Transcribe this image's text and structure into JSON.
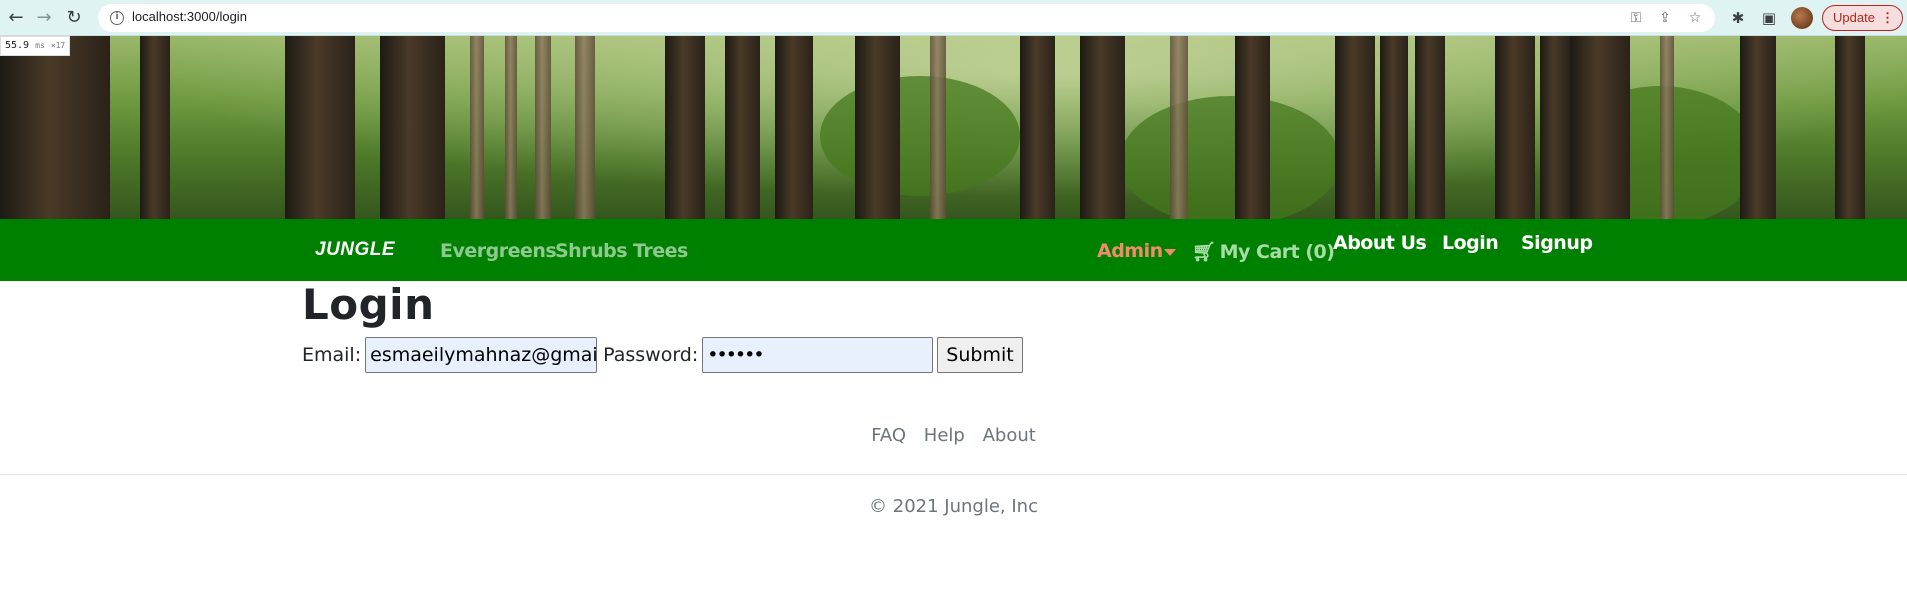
{
  "browser": {
    "url": "localhost:3000/login",
    "update_label": "Update",
    "perf_value": "55.9",
    "perf_unit": "ms",
    "perf_count": "×17"
  },
  "navbar": {
    "brand": "JUNGLE",
    "categories": [
      "Evergreens",
      "Shrubs",
      "Trees"
    ],
    "admin_label": "Admin",
    "cart_label": "My Cart (0)",
    "about_label": "About Us",
    "login_label": "Login",
    "signup_label": "Signup"
  },
  "main": {
    "title": "Login",
    "email_label": "Email:",
    "email_value": "esmaeilymahnaz@gmail.com",
    "password_label": "Password:",
    "password_value": "••••••",
    "submit_label": "Submit"
  },
  "footer": {
    "links": [
      "FAQ",
      "Help",
      "About"
    ],
    "copyright": "© 2021 Jungle, Inc"
  },
  "colors": {
    "navbar_bg": "#008000",
    "admin_color": "#f08c6c",
    "category_link": "#8fc98f"
  },
  "icons": {
    "back": "back-arrow-icon",
    "forward": "forward-arrow-icon",
    "reload": "reload-icon",
    "info": "info-icon",
    "key": "key-icon",
    "share": "share-icon",
    "star": "star-icon",
    "extensions": "puzzle-icon",
    "sidepanel": "side-panel-icon",
    "cart": "cart-icon"
  }
}
